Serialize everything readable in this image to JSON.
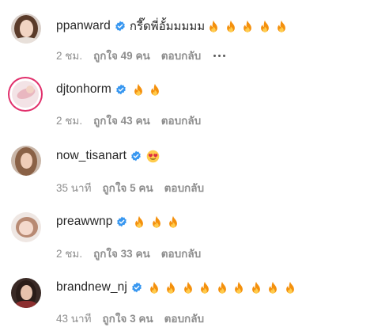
{
  "comments": [
    {
      "username": "ppanward",
      "text": "กรี๊ดพี่อั้มมมมม",
      "emoji": "flame",
      "emoji_count": 5,
      "time": "2 ชม.",
      "likes": "ถูกใจ 49 คน",
      "reply": "ตอบกลับ",
      "show_more": true
    },
    {
      "username": "djtonhorm",
      "text": "",
      "emoji": "flame",
      "emoji_count": 2,
      "time": "2 ชม.",
      "likes": "ถูกใจ 43 คน",
      "reply": "ตอบกลับ",
      "show_more": false
    },
    {
      "username": "now_tisanart",
      "text": "",
      "emoji": "heart-eyes",
      "emoji_count": 1,
      "time": "35 นาที",
      "likes": "ถูกใจ 5 คน",
      "reply": "ตอบกลับ",
      "show_more": false
    },
    {
      "username": "preawwnp",
      "text": "",
      "emoji": "flame",
      "emoji_count": 3,
      "time": "2 ชม.",
      "likes": "ถูกใจ 33 คน",
      "reply": "ตอบกลับ",
      "show_more": false
    },
    {
      "username": "brandnew_nj",
      "text": "",
      "emoji": "flame",
      "emoji_count": 9,
      "time": "43 นาที",
      "likes": "ถูกใจ 3 คน",
      "reply": "ตอบกลับ",
      "show_more": false
    }
  ],
  "colors": {
    "verified": "#3897f0",
    "meta_text": "#8e8e8e",
    "story_ring": "#e1306c"
  }
}
